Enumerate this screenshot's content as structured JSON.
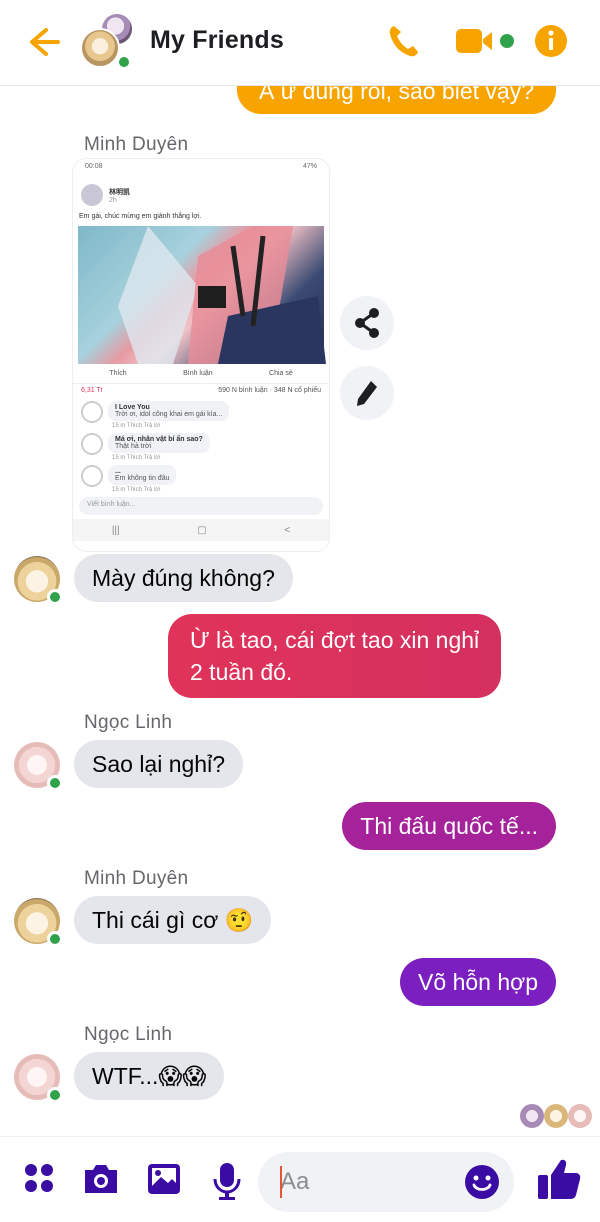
{
  "header": {
    "title": "My Friends"
  },
  "colors": {
    "accent": "#f7a400",
    "online": "#31a24c",
    "outgoing_purple": "#8a1fb8",
    "outgoing_pink": "#e0335a",
    "icon_blue": "#3a0ca3"
  },
  "messages": {
    "top_outgoing": "À ừ đúng rồi, sao biết vậy?",
    "sender_1": "Minh Duyên",
    "msg_1": "Mày đúng không?",
    "out_1": "Ừ là tao, cái đợt tao xin nghỉ\n2 tuần đó.",
    "sender_2": "Ngọc Linh",
    "msg_2": "Sao lại nghỉ?",
    "out_2": "Thi đấu quốc tế...",
    "sender_3": "Minh Duyên",
    "msg_3": "Thi cái gì cơ 🤨",
    "out_3": "Võ hỗn hợp",
    "sender_4": "Ngọc Linh",
    "msg_4": "WTF...😱😱"
  },
  "shot": {
    "time": "00:08",
    "battery": "47%",
    "page_name": "林明凯",
    "post_time": "2h",
    "caption": "Em gái, chúc mừng em giành thắng lợi.",
    "like": "Thích",
    "comment": "Bình luận",
    "share": "Chia sẻ",
    "reactions": "6,31 Tr",
    "stats": "590 N bình luận · 348 N cổ phiếu",
    "c1_name": "I Love You",
    "c1_text": "Trời ơi, idol công khai em gái kìa...",
    "c1_meta": "15 m   Thích   Trả lời",
    "c2_name": "Má ơi, nhân vật bí ẩn sao?",
    "c2_text": "Thật hả trời",
    "c2_meta": "15 m   Thích   Trả lời",
    "c3_name": "...",
    "c3_text": "Em không tin đâu",
    "c3_meta": "15 m   Thích   Trả lời",
    "write_comment": "Viết bình luận..."
  },
  "composer": {
    "placeholder": "Aa"
  }
}
